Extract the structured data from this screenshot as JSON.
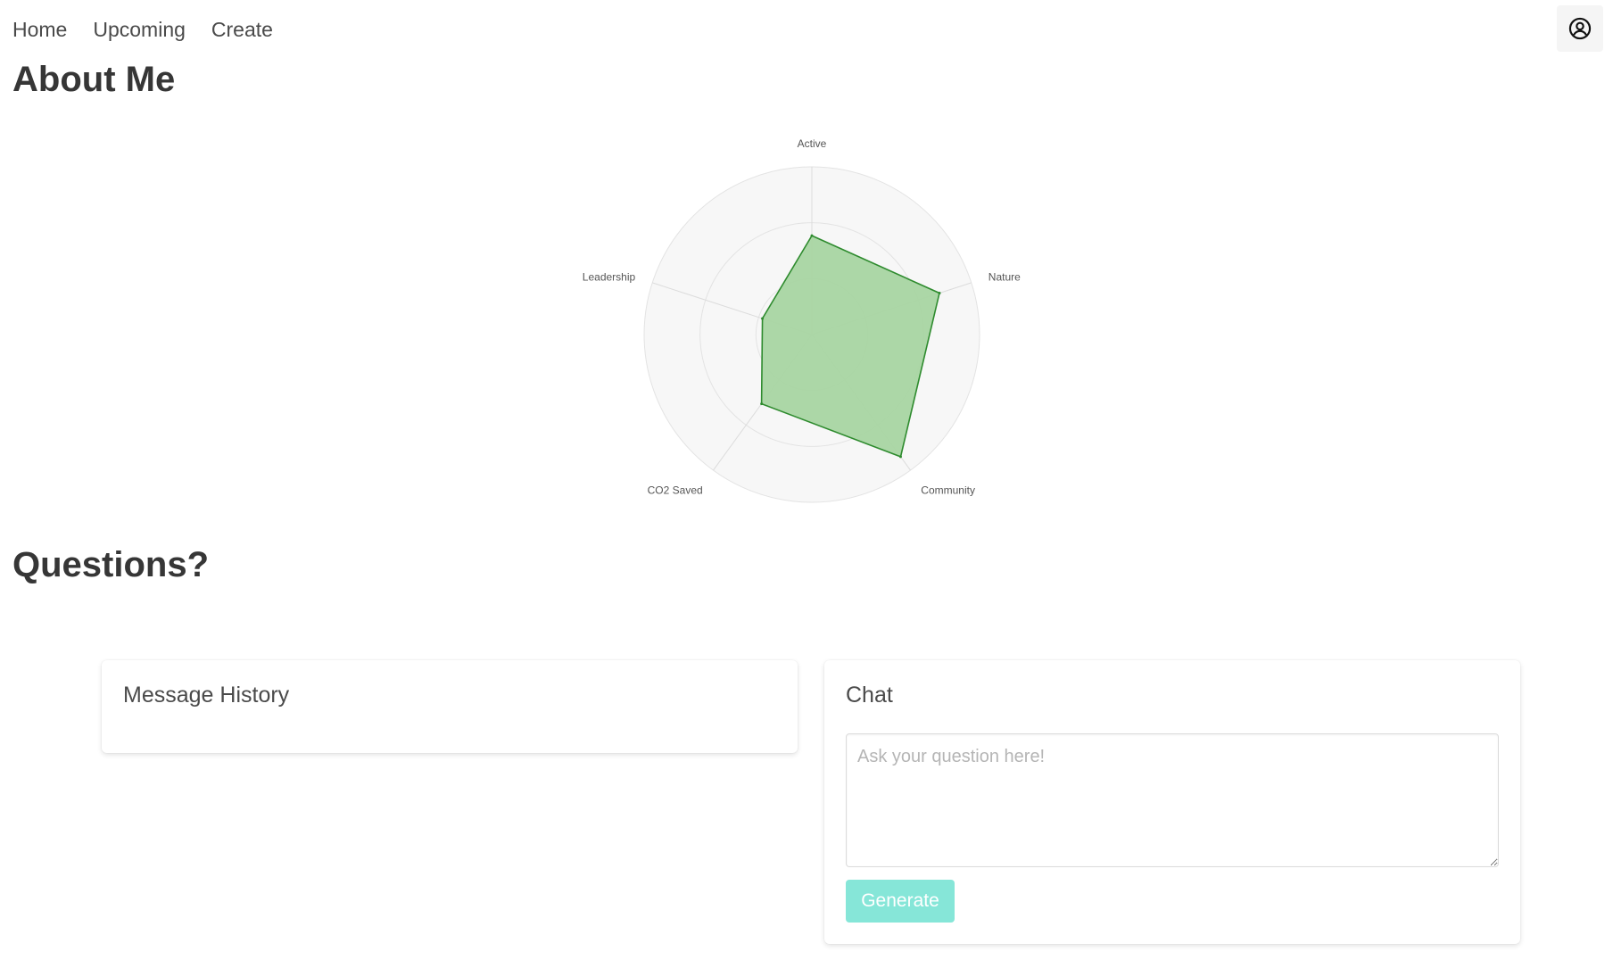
{
  "nav": {
    "links": [
      "Home",
      "Upcoming",
      "Create"
    ],
    "profile_icon": "user-circle-icon"
  },
  "about": {
    "title": "About Me"
  },
  "chart_data": {
    "type": "radar",
    "axes": [
      "Active",
      "Nature",
      "Community",
      "CO2 Saved",
      "Leadership"
    ],
    "values": [
      0.59,
      0.8,
      0.9,
      0.51,
      0.31
    ],
    "rlim": [
      0,
      1
    ],
    "rings": 3,
    "fill_color": "#a8d5a2",
    "stroke_color": "#2e8b2e",
    "grid": true
  },
  "questions": {
    "title": "Questions?",
    "history": {
      "title": "Message History"
    },
    "chat": {
      "title": "Chat",
      "placeholder": "Ask your question here!",
      "button_label": "Generate"
    }
  },
  "colors": {
    "accent": "#86e6d8",
    "heading": "#363636"
  }
}
